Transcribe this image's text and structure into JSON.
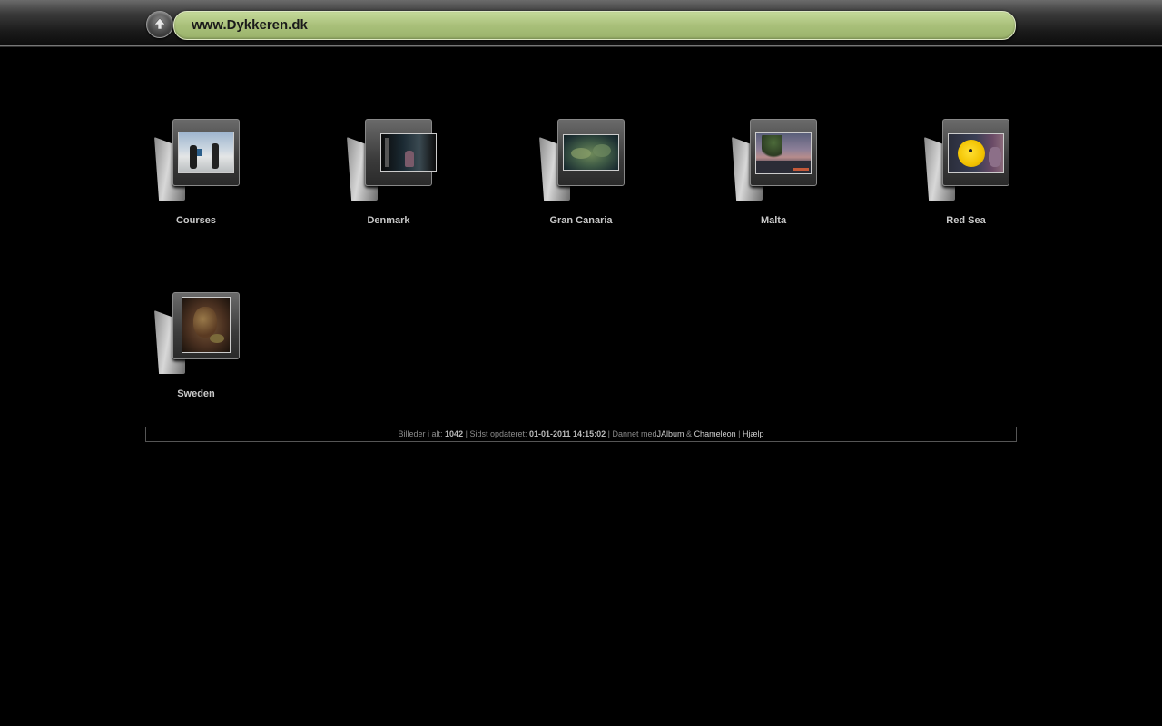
{
  "header": {
    "title": "www.Dykkeren.dk",
    "up_icon": "up-arrow-icon"
  },
  "folders": [
    {
      "label": "Courses",
      "icon": "folder-icon"
    },
    {
      "label": "Denmark",
      "icon": "folder-icon"
    },
    {
      "label": "Gran Canaria",
      "icon": "folder-icon"
    },
    {
      "label": "Malta",
      "icon": "folder-icon"
    },
    {
      "label": "Red Sea",
      "icon": "folder-icon"
    },
    {
      "label": "Sweden",
      "icon": "folder-icon"
    }
  ],
  "footer": {
    "images_label": "Billeder i alt:",
    "images_count": "1042",
    "sep1": "|",
    "updated_label": "Sidst opdateret:",
    "updated_value": "01-01-2011 14:15:02",
    "sep2": "|",
    "made_with": "Dannet med",
    "jalbum": "JAlbum",
    "amp": "&",
    "chameleon": "Chameleon",
    "sep3": "|",
    "help": "Hjælp"
  }
}
